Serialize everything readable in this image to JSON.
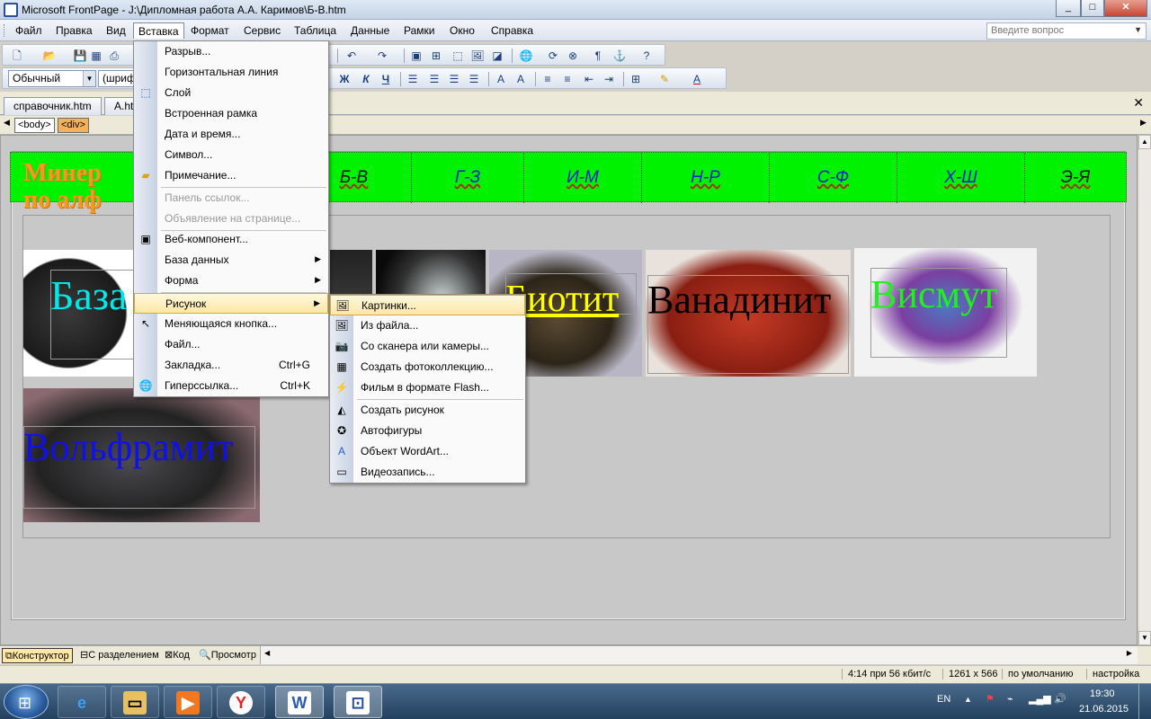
{
  "window": {
    "title": "Microsoft FrontPage - J:\\Дипломная работа А.А. Каримов\\Б-В.htm",
    "min": "_",
    "max": "□",
    "close": "✕"
  },
  "menubar": {
    "items": [
      "Файл",
      "Правка",
      "Вид",
      "Вставка",
      "Формат",
      "Сервис",
      "Таблица",
      "Данные",
      "Рамки",
      "Окно",
      "Справка"
    ],
    "ask_placeholder": "Введите вопрос"
  },
  "format_toolbar": {
    "style": "Обычный",
    "font": "(шриф",
    "bold": "Ж",
    "italic": "К",
    "underline": "Ч"
  },
  "doc_tabs": [
    "справочник.htm",
    "А.htm"
  ],
  "tag_selector": [
    "<body>",
    "<div>"
  ],
  "page": {
    "title_line1": "Минер",
    "title_line2": "по алф",
    "nav": [
      "Б-В",
      "Г-З",
      "И-М",
      "Н-Р",
      "С-Ф",
      "Х-Ш",
      "Э-Я"
    ],
    "minerals": [
      "База",
      "Биотит",
      "Ванадинит",
      "Висмут",
      "Вольфрамит"
    ]
  },
  "insert_menu": {
    "items": [
      {
        "label": "Разрыв...",
        "disabled": false
      },
      {
        "label": "Горизонтальная линия",
        "disabled": false
      },
      {
        "label": "Слой",
        "disabled": false
      },
      {
        "label": "Встроенная рамка",
        "disabled": false
      },
      {
        "label": "Дата и время...",
        "disabled": false
      },
      {
        "label": "Символ...",
        "disabled": false
      },
      {
        "label": "Примечание...",
        "disabled": false
      },
      {
        "label": "Панель ссылок...",
        "disabled": true
      },
      {
        "label": "Объявление на странице...",
        "disabled": true
      },
      {
        "label": "Веб-компонент...",
        "disabled": false
      },
      {
        "label": "База данных",
        "disabled": false
      },
      {
        "label": "Форма",
        "disabled": false
      },
      {
        "label": "Рисунок",
        "disabled": false
      },
      {
        "label": "Меняющаяся кнопка...",
        "disabled": false
      },
      {
        "label": "Файл...",
        "disabled": false
      },
      {
        "label": "Закладка...",
        "disabled": false,
        "shortcut": "Ctrl+G"
      },
      {
        "label": "Гиперссылка...",
        "disabled": false,
        "shortcut": "Ctrl+K"
      }
    ]
  },
  "picture_submenu": {
    "items": [
      "Картинки...",
      "Из файла...",
      "Со сканера или камеры...",
      "Создать фотоколлекцию...",
      "Фильм в формате Flash...",
      "Создать рисунок",
      "Автофигуры",
      "Объект WordArt...",
      "Видеозапись..."
    ]
  },
  "view_tabs": [
    "Конструктор",
    "С разделением",
    "Код",
    "Просмотр"
  ],
  "status": {
    "speed": "4:14 при 56 кбит/с",
    "size": "1261 x 566",
    "mode": "по умолчанию",
    "settings": "настройка"
  },
  "taskbar": {
    "lang": "EN",
    "time": "19:30",
    "date": "21.06.2015"
  }
}
